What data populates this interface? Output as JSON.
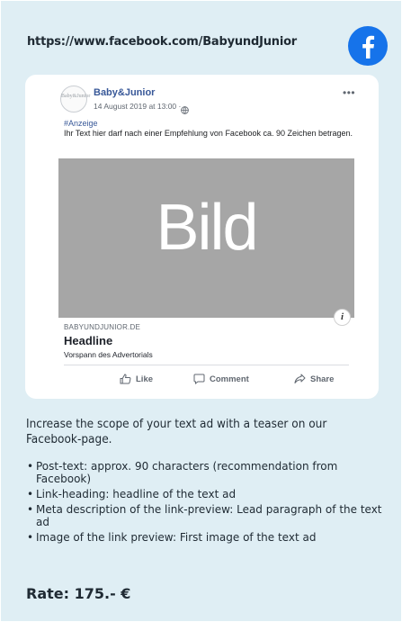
{
  "header": {
    "url": "https://www.facebook.com/BabyundJunior",
    "logo_icon": "facebook-logo-icon",
    "brand_color": "#1673ea"
  },
  "post": {
    "avatar_text": "Baby&Junior",
    "page_name": "Baby&Junior",
    "date": "14 August 2019 at 13:00 ·",
    "more_icon": "more-options-icon",
    "hashtag": "#Anzeige",
    "text": "Ihr Text hier darf nach einer Empfehlung von Facebook ca. 90 Zeichen betragen.",
    "image_label": "Bild",
    "image_color": "#a6a6a6",
    "info_label": "i",
    "link": {
      "domain": "BABYUNDJUNIOR.DE",
      "headline": "Headline",
      "description": "Vorspann des Advertorials"
    },
    "actions": [
      {
        "label": "Like",
        "icon": "thumbs-up-icon"
      },
      {
        "label": "Comment",
        "icon": "comment-icon"
      },
      {
        "label": "Share",
        "icon": "share-icon"
      }
    ]
  },
  "description": "Increase the scope of your text ad with a teaser on our Facebook-page.",
  "bullets": [
    "Post-text: approx. 90 characters (recommendation from Facebook)",
    "Link-heading: headline of the text ad",
    "Meta description of the link-preview: Lead paragraph of the text ad",
    "Image of the link preview: First image of the text ad"
  ],
  "rate": "Rate: 175.- €",
  "colors": {
    "panel_background": "#dfeef4",
    "link_blue": "#385898"
  }
}
